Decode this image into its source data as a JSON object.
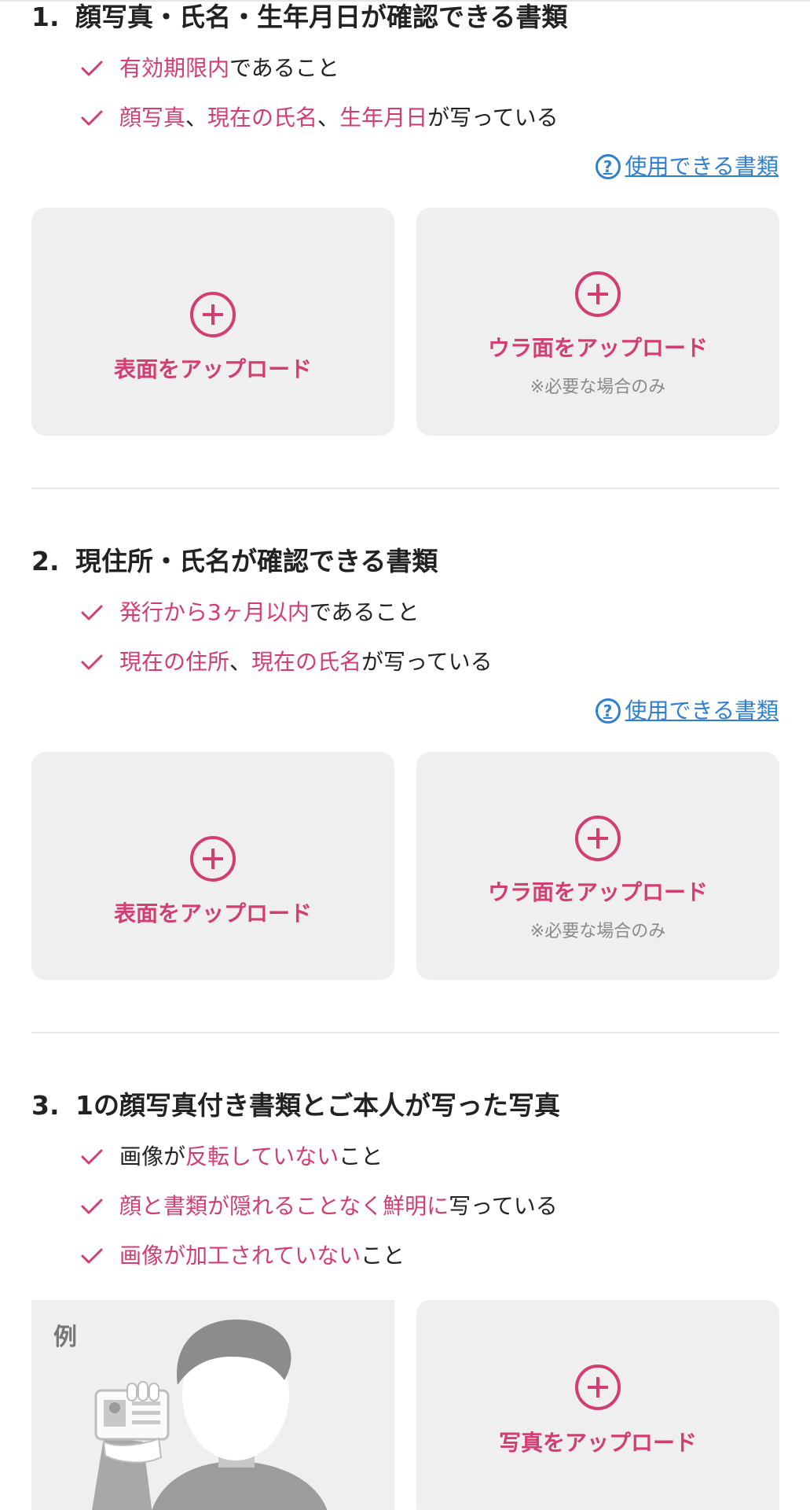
{
  "colors": {
    "accent": "#d43d72",
    "link": "#2f7fd1",
    "card_bg": "#efefef"
  },
  "sections": [
    {
      "num": "1.",
      "title": "顔写真・氏名・生年月日が確認できる書類",
      "checks": [
        [
          {
            "t": "有効期限内",
            "pink": true
          },
          {
            "t": "であること",
            "pink": false
          }
        ],
        [
          {
            "t": "顔写真",
            "pink": true
          },
          {
            "t": "、",
            "pink": false
          },
          {
            "t": "現在の氏名",
            "pink": true
          },
          {
            "t": "、",
            "pink": false
          },
          {
            "t": "生年月日",
            "pink": true
          },
          {
            "t": "が写っている",
            "pink": false
          }
        ]
      ],
      "help_link": "使用できる書類",
      "front_label": "表面をアップロード",
      "back_label": "ウラ面をアップロード",
      "back_note": "※必要な場合のみ"
    },
    {
      "num": "2.",
      "title": "現住所・氏名が確認できる書類",
      "checks": [
        [
          {
            "t": "発行から3ヶ月以内",
            "pink": true
          },
          {
            "t": "であること",
            "pink": false
          }
        ],
        [
          {
            "t": "現在の住所",
            "pink": true
          },
          {
            "t": "、",
            "pink": false
          },
          {
            "t": "現在の氏名",
            "pink": true
          },
          {
            "t": "が写っている",
            "pink": false
          }
        ]
      ],
      "help_link": "使用できる書類",
      "front_label": "表面をアップロード",
      "back_label": "ウラ面をアップロード",
      "back_note": "※必要な場合のみ"
    },
    {
      "num": "3.",
      "title": "1の顔写真付き書類とご本人が写った写真",
      "checks": [
        [
          {
            "t": "画像が",
            "pink": false
          },
          {
            "t": "反転していない",
            "pink": true
          },
          {
            "t": "こと",
            "pink": false
          }
        ],
        [
          {
            "t": "顔と書類が隠れることなく鮮明に",
            "pink": true
          },
          {
            "t": "写っている",
            "pink": false
          }
        ],
        [
          {
            "t": "画像が加工されていない",
            "pink": true
          },
          {
            "t": "こと",
            "pink": false
          }
        ]
      ],
      "example_label": "例",
      "upload_label": "写真をアップロード"
    }
  ]
}
